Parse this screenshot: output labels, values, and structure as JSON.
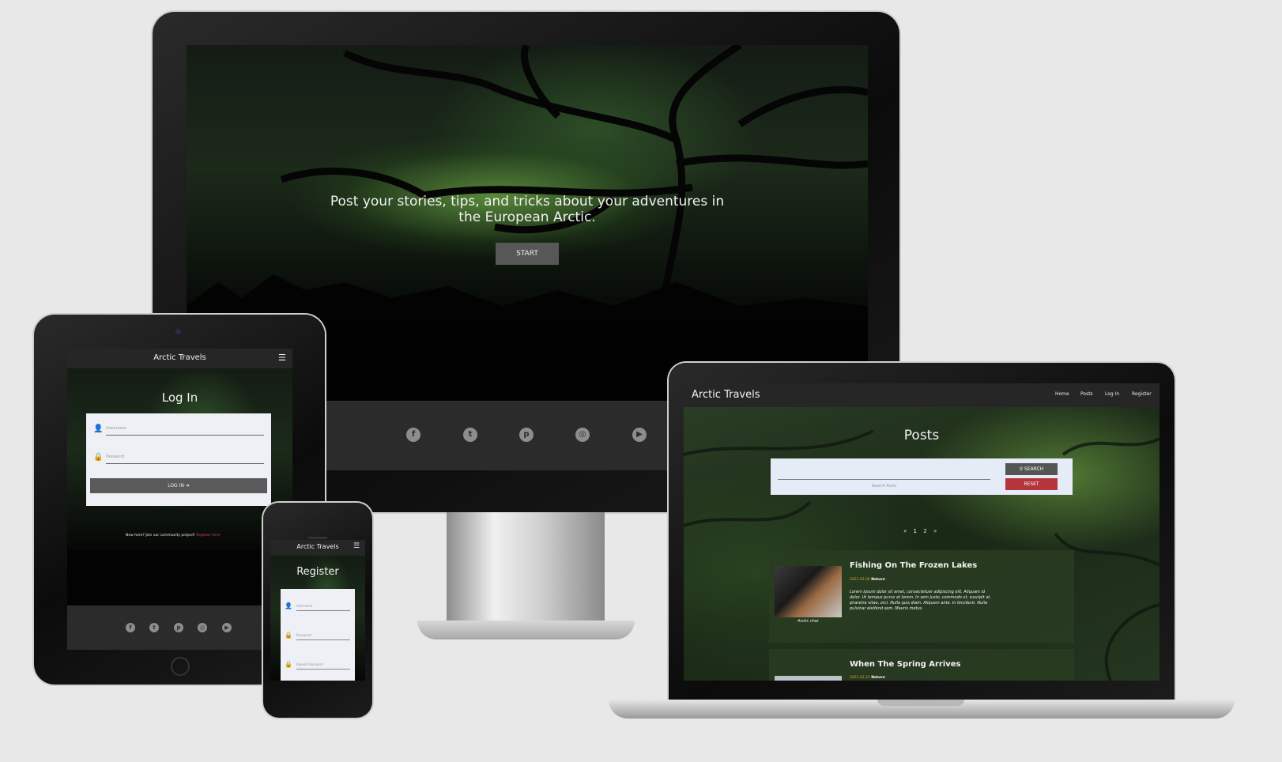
{
  "desktop": {
    "hero_text": "Post your stories, tips, and tricks about your adventures in the European Arctic.",
    "start_label": "START",
    "social": [
      {
        "icon": "facebook-icon",
        "glyph": "f"
      },
      {
        "icon": "twitter-icon",
        "glyph": "t"
      },
      {
        "icon": "pinterest-icon",
        "glyph": "p"
      },
      {
        "icon": "instagram-icon",
        "glyph": "◎"
      },
      {
        "icon": "youtube-icon",
        "glyph": "▶"
      }
    ]
  },
  "tablet": {
    "brand": "Arctic Travels",
    "title": "Log In",
    "username_placeholder": "Username",
    "password_placeholder": "Password",
    "login_label": "LOG IN ➜",
    "register_prompt": "New here? Join our community project!",
    "register_link": "Register here"
  },
  "phone": {
    "brand": "Arctic Travels",
    "title": "Register",
    "username_placeholder": "Username",
    "password_placeholder": "Password",
    "repeat_placeholder": "Repeat Password"
  },
  "laptop": {
    "brand": "Arctic Travels",
    "nav": [
      "Home",
      "Posts",
      "Log In",
      "Register"
    ],
    "title": "Posts",
    "search_placeholder": "Search Posts",
    "search_label": "SEARCH",
    "reset_label": "RESET",
    "pagination": [
      "«",
      "1",
      "2",
      "»"
    ],
    "posts": [
      {
        "title": "Fishing On The Frozen Lakes",
        "date": "2022.02.06",
        "category": "Nature",
        "caption": "Arctic char",
        "excerpt": "Lorem ipsum dolor sit amet, consectetuer adipiscing elit. Aliquam id dolor. Ut tempus purus at lorem. In sem justo, commodo ut, suscipit at, pharetra vitae, orci. Nulla quis diam. Aliquam ante. In tincidunt. Nulla pulvinar eleifend sem. Mauris metus."
      },
      {
        "title": "When The Spring Arrives",
        "date": "2022.01.21",
        "category": "Nature"
      }
    ]
  },
  "colors": {
    "page_bg": "#e8e8e8",
    "accent_red": "#b5353b",
    "date_orange": "#d6a23a",
    "nav_bar": "#262626",
    "footer_bar": "#2b2b2b"
  }
}
